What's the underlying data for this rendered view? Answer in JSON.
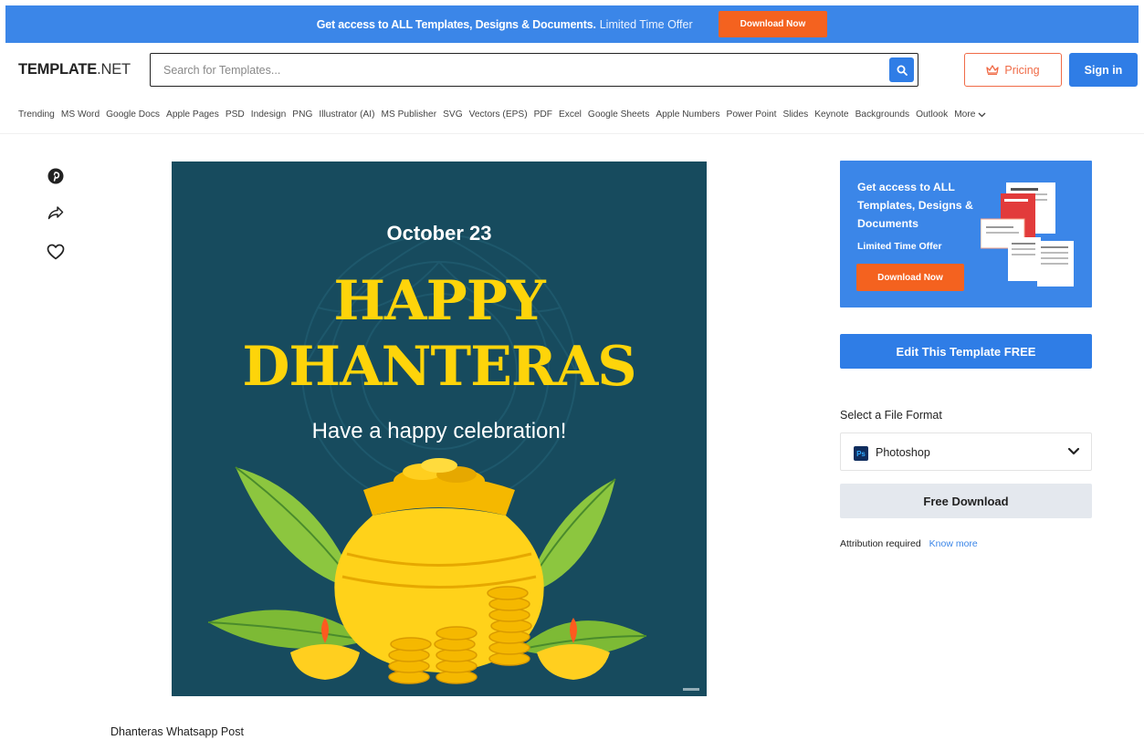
{
  "topbar": {
    "message": "Get access to ALL Templates, Designs & Documents.",
    "offer": "Limited Time Offer",
    "button": "Download Now"
  },
  "header": {
    "logo_bold": "TEMPLATE",
    "logo_suffix": ".NET",
    "search_placeholder": "Search for Templates...",
    "pricing_label": "Pricing",
    "signin_label": "Sign in"
  },
  "categories": [
    "Trending",
    "MS Word",
    "Google Docs",
    "Apple Pages",
    "PSD",
    "Indesign",
    "PNG",
    "Illustrator (AI)",
    "MS Publisher",
    "SVG",
    "Vectors (EPS)",
    "PDF",
    "Excel",
    "Google Sheets",
    "Apple Numbers",
    "Power Point",
    "Slides",
    "Keynote",
    "Backgrounds",
    "Outlook"
  ],
  "more_label": "More",
  "social_icons": [
    "pinterest-icon",
    "share-icon",
    "heart-icon"
  ],
  "poster": {
    "date": "October 23",
    "line1": "HAPPY",
    "line2": "DHANTERAS",
    "subtitle": "Have a happy celebration!",
    "bg_color": "#174b5e",
    "accent_color": "#fed40a"
  },
  "promo": {
    "text": "Get access to ALL Templates, Designs & Documents",
    "limited": "Limited Time Offer",
    "button": "Download Now"
  },
  "edit_button": "Edit This Template FREE",
  "format": {
    "label": "Select a File Format",
    "selected": "Photoshop",
    "badge": "Ps"
  },
  "free_download": "Free Download",
  "attribution": {
    "text": "Attribution required",
    "link": "Know more"
  },
  "template_title": "Dhanteras Whatsapp Post",
  "colors": {
    "primary_blue": "#2f7de6",
    "orange": "#f4621f",
    "pricing_orange": "#f06b47"
  }
}
